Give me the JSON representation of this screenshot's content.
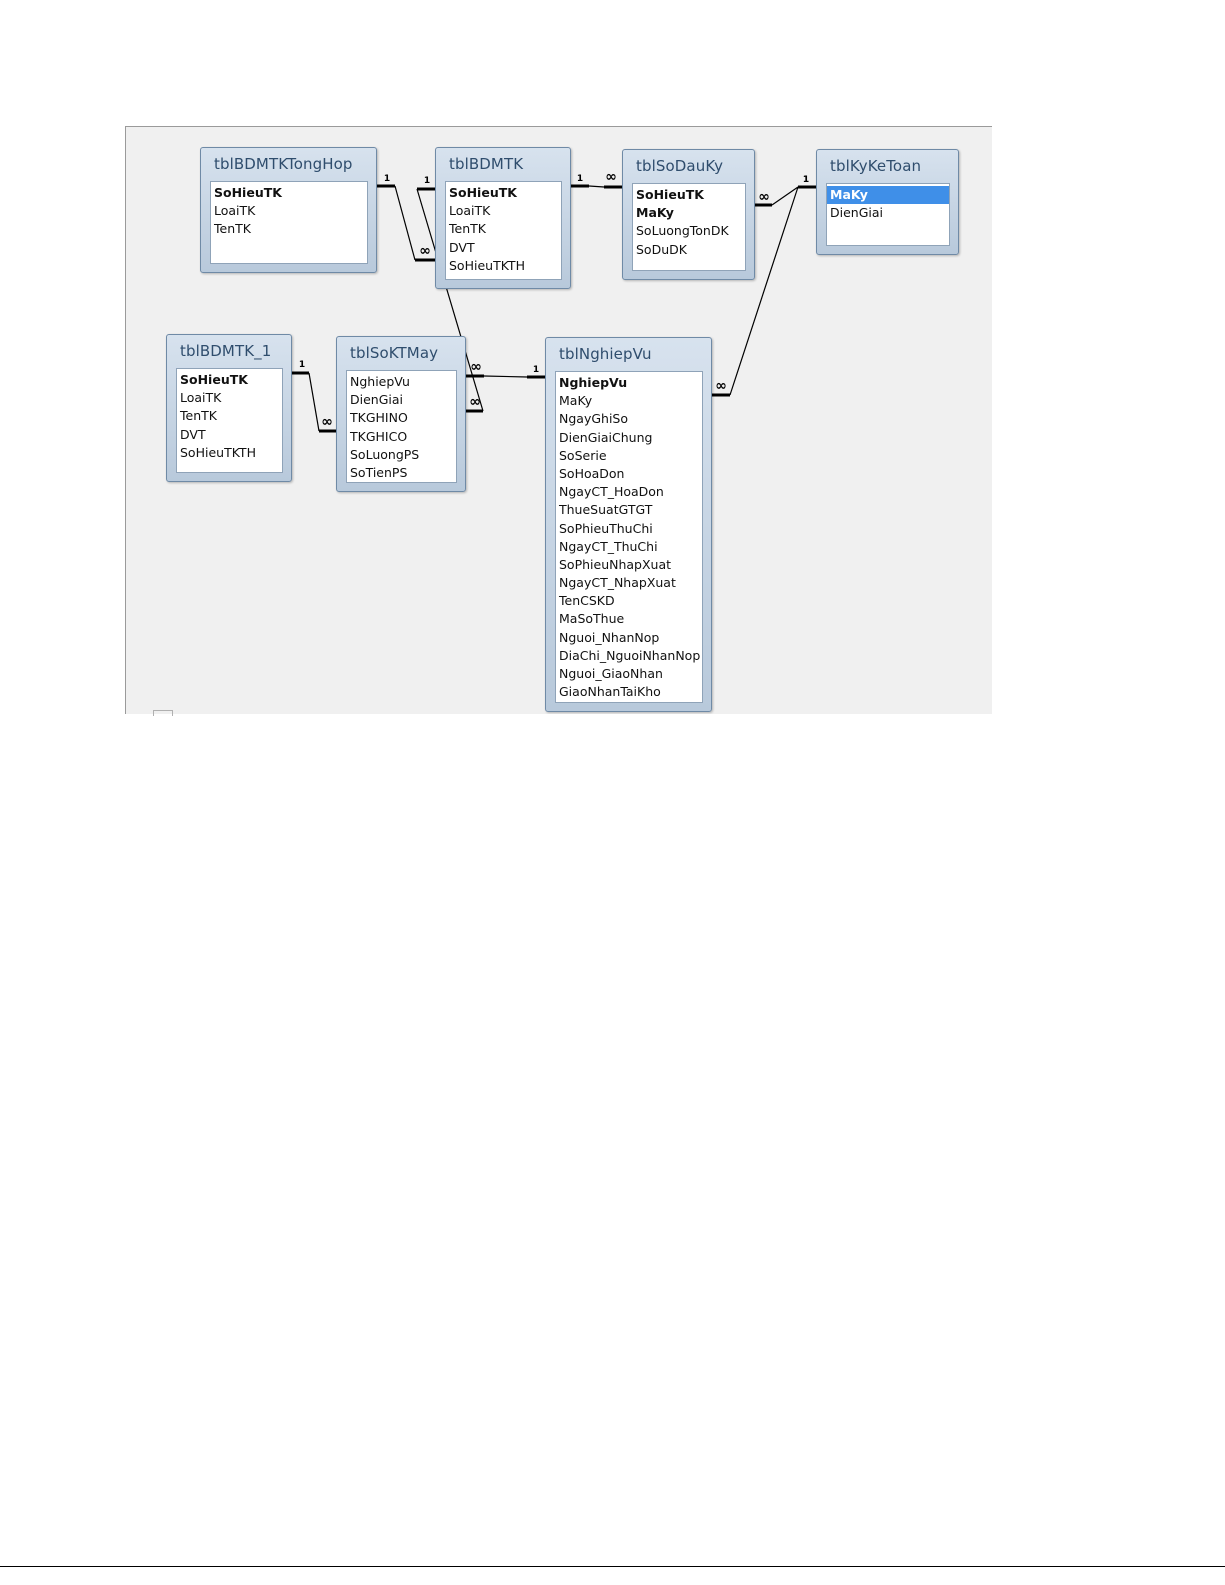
{
  "diagram": {
    "tables": [
      {
        "id": "tongHop",
        "title": "tblBDMTKTongHop",
        "fields": [
          "SoHieuTK",
          "LoaiTK",
          "TenTK"
        ],
        "keys": [
          0
        ]
      },
      {
        "id": "bdmtk",
        "title": "tblBDMTK",
        "fields": [
          "SoHieuTK",
          "LoaiTK",
          "TenTK",
          "DVT",
          "SoHieuTKTH"
        ],
        "keys": [
          0
        ]
      },
      {
        "id": "soDauKy",
        "title": "tblSoDauKy",
        "fields": [
          "SoHieuTK",
          "MaKy",
          "SoLuongTonDK",
          "SoDuDK"
        ],
        "keys": [
          0,
          1
        ]
      },
      {
        "id": "kyKeToan",
        "title": "tblKyKeToan",
        "fields": [
          "MaKy",
          "DienGiai"
        ],
        "keys": [
          0
        ],
        "selected": 0
      },
      {
        "id": "bdmtk1",
        "title": "tblBDMTK_1",
        "fields": [
          "SoHieuTK",
          "LoaiTK",
          "TenTK",
          "DVT",
          "SoHieuTKTH"
        ],
        "keys": [
          0
        ]
      },
      {
        "id": "soKTMay",
        "title": "tblSoKTMay",
        "fields": [
          "NghiepVu",
          "DienGiai",
          "TKGHINO",
          "TKGHICO",
          "SoLuongPS",
          "SoTienPS"
        ],
        "keys": []
      },
      {
        "id": "nghiepVu",
        "title": "tblNghiepVu",
        "fields": [
          "NghiepVu",
          "MaKy",
          "NgayGhiSo",
          "DienGiaiChung",
          "SoSerie",
          "SoHoaDon",
          "NgayCT_HoaDon",
          "ThueSuatGTGT",
          "SoPhieuThuChi",
          "NgayCT_ThuChi",
          "SoPhieuNhapXuat",
          "NgayCT_NhapXuat",
          "TenCSKD",
          "MaSoThue",
          "Nguoi_NhanNop",
          "DiaChi_NguoiNhanNop",
          "Nguoi_GiaoNhan",
          "GiaoNhanTaiKho"
        ],
        "keys": [
          0
        ]
      }
    ],
    "relationships": [
      {
        "from": "tongHop",
        "from_end": "1",
        "to": "bdmtk",
        "to_end": "∞"
      },
      {
        "from": "bdmtk",
        "from_end": "1",
        "to": "soDauKy",
        "to_end": "∞"
      },
      {
        "from": "kyKeToan",
        "from_end": "1",
        "to": "soDauKy",
        "to_end": "∞"
      },
      {
        "from": "kyKeToan",
        "from_end": "1",
        "to": "nghiepVu",
        "to_end": "∞"
      },
      {
        "from": "bdmtk1",
        "from_end": "1",
        "to": "soKTMay",
        "to_end": "∞"
      },
      {
        "from": "nghiepVu",
        "from_end": "1",
        "to": "soKTMay",
        "to_end": "∞"
      },
      {
        "from": "bdmtk",
        "from_end": "1",
        "to": "soKTMay",
        "to_end": "∞"
      }
    ]
  }
}
